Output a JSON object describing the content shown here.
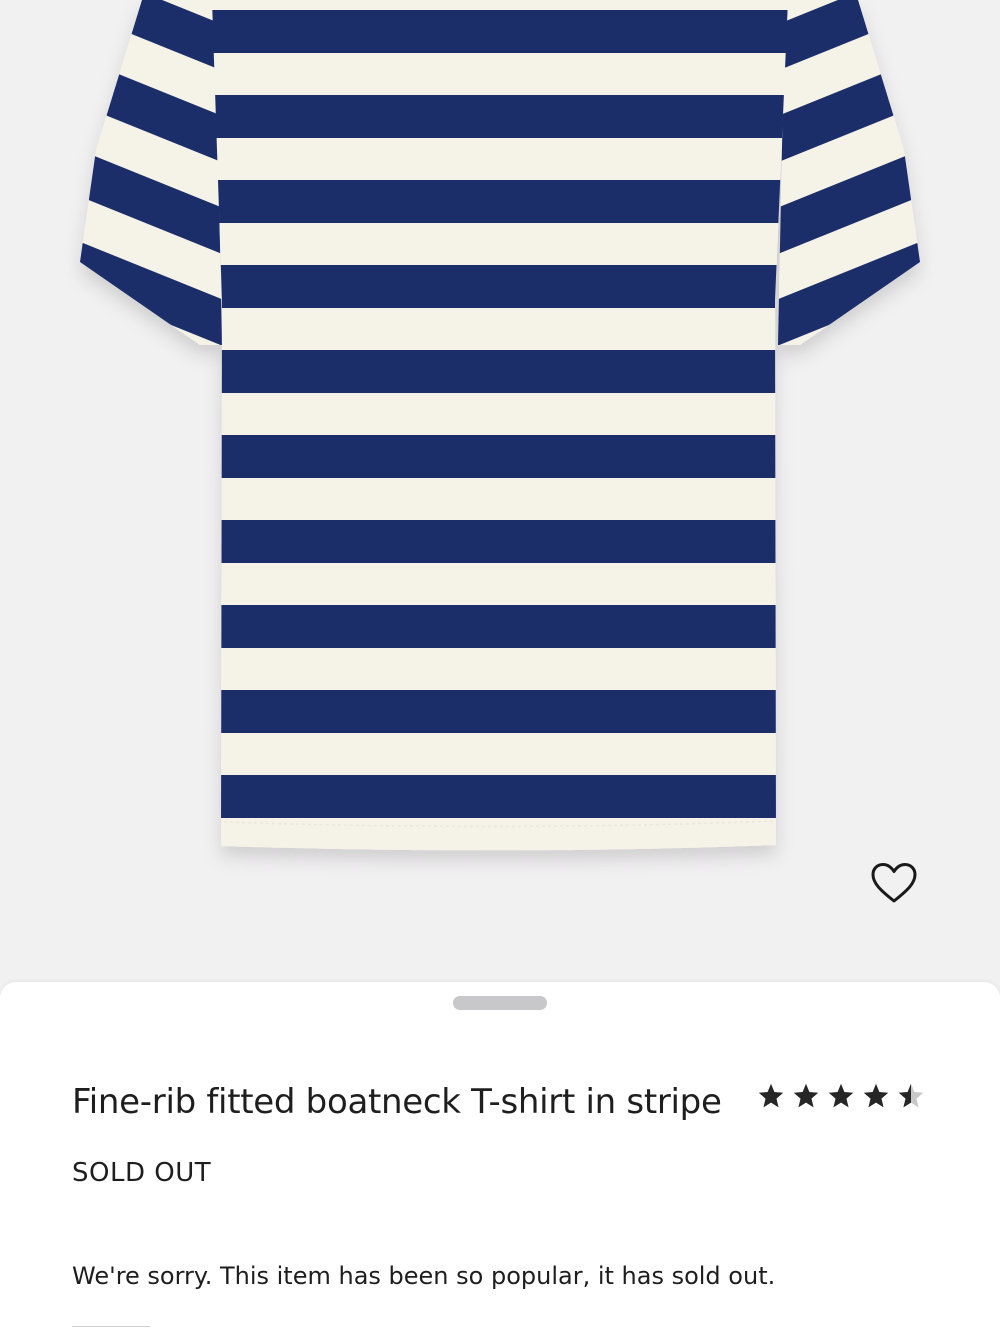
{
  "product": {
    "name": "Fine-rib fitted boatneck T-shirt in stripe",
    "status": "SOLD OUT",
    "message": "We're sorry. This item has been so popular, it has sold out.",
    "rating": 4.5,
    "rating_max": 5
  },
  "colors": {
    "stripe_navy": "#1e2e6b",
    "stripe_cream": "#f5f2e8",
    "background": "#f2f1f2",
    "sheet": "#ffffff",
    "text": "#1e1e1e"
  },
  "icons": {
    "wishlist": "heart-outline-icon",
    "star": "star-icon"
  }
}
